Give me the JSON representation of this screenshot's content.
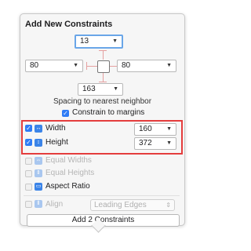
{
  "panel": {
    "title": "Add New Constraints",
    "top_value": "13",
    "left_value": "80",
    "right_value": "80",
    "bottom_value": "163",
    "spacing_label": "Spacing to nearest neighbor",
    "constrain_margins_label": "Constrain to margins",
    "constrain_margins_checked": true
  },
  "dimensions": [
    {
      "label": "Width",
      "checked": true,
      "value": "160",
      "icon": "width-icon"
    },
    {
      "label": "Height",
      "checked": true,
      "value": "372",
      "icon": "height-icon"
    }
  ],
  "options": [
    {
      "label": "Equal Widths",
      "checked": false,
      "enabled": false,
      "icon": "equal-widths-icon"
    },
    {
      "label": "Equal Heights",
      "checked": false,
      "enabled": false,
      "icon": "equal-heights-icon"
    },
    {
      "label": "Aspect Ratio",
      "checked": false,
      "enabled": true,
      "icon": "aspect-ratio-icon"
    }
  ],
  "align": {
    "label": "Align",
    "value": "Leading Edges",
    "enabled": false
  },
  "add_button": "Add 2 Constraints",
  "colors": {
    "accent": "#2f7cf6",
    "highlight": "#e43d3d",
    "constraint_line": "#e5a0a0"
  }
}
